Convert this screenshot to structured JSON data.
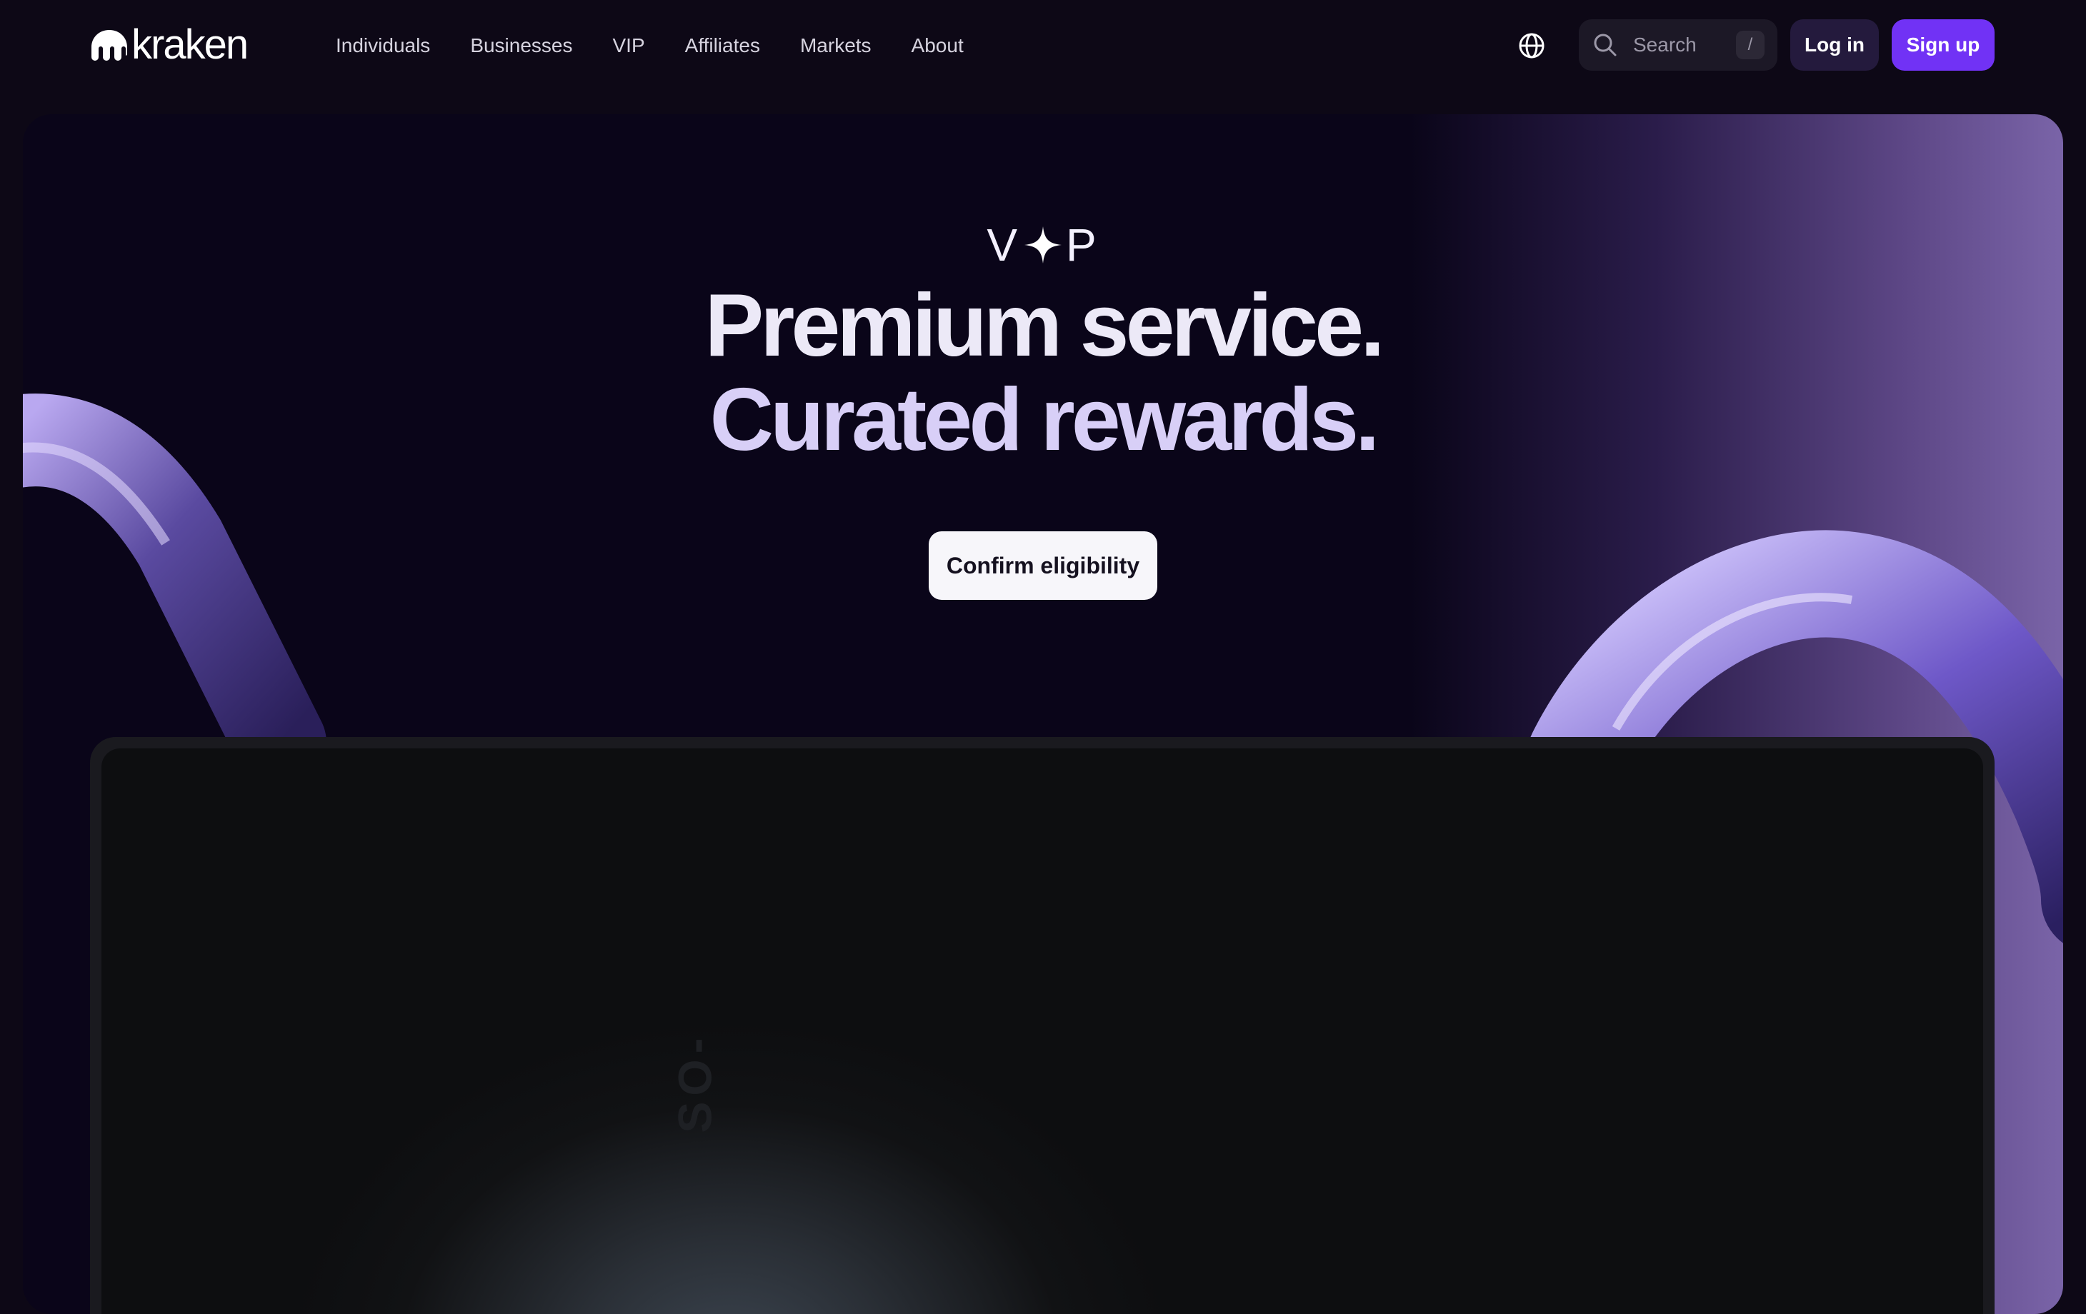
{
  "nav": {
    "logo_text": "kraken",
    "links": [
      "Individuals",
      "Businesses",
      "VIP",
      "Affiliates",
      "Markets",
      "About"
    ],
    "search_placeholder": "Search",
    "search_shortcut": "/",
    "login_label": "Log in",
    "signup_label": "Sign up"
  },
  "hero": {
    "badge_left": "V",
    "badge_right": "P",
    "headline_line1": "Premium service.",
    "headline_line2": "Curated rewards.",
    "cta_label": "Confirm eligibility",
    "video_overlay_text": "SO-"
  },
  "colors": {
    "page_bg": "#0d0816",
    "accent": "#7132f5",
    "hero_bg": "#0a0519",
    "hero_gradient_end": "#7a64a8",
    "cta_bg": "#f7f6fa"
  },
  "icons": {
    "logo": "kraken-logo-icon",
    "globe": "globe-icon",
    "search": "search-icon",
    "vip_star": "sparkle-icon"
  }
}
